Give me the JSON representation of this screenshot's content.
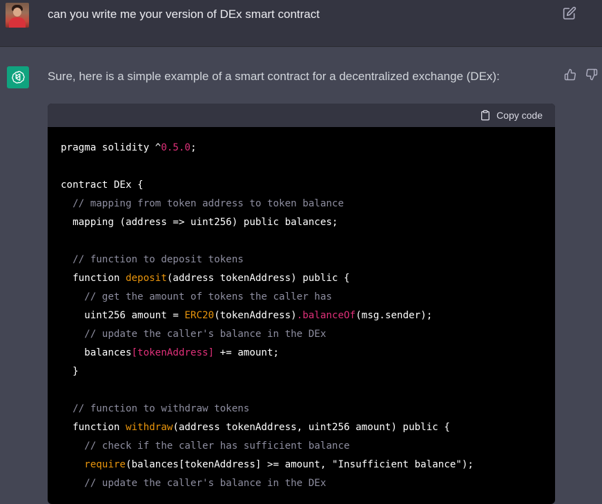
{
  "user_message": {
    "text": "can you write me your version of DEx smart contract"
  },
  "assistant_message": {
    "text": "Sure, here is a simple example of a smart contract for a decentralized exchange (DEx):"
  },
  "code_block": {
    "copy_label": "Copy code",
    "lines": [
      [
        {
          "t": "pragma solidity ^",
          "c": ""
        },
        {
          "t": "0.5.0",
          "c": "num"
        },
        {
          "t": ";",
          "c": ""
        }
      ],
      [],
      [
        {
          "t": "contract DEx {",
          "c": ""
        }
      ],
      [
        {
          "t": "  // mapping from token address to token balance",
          "c": "cmt"
        }
      ],
      [
        {
          "t": "  mapping (address => uint256) public balances;",
          "c": ""
        }
      ],
      [],
      [
        {
          "t": "  // function to deposit tokens",
          "c": "cmt"
        }
      ],
      [
        {
          "t": "  function ",
          "c": ""
        },
        {
          "t": "deposit",
          "c": "fn"
        },
        {
          "t": "(address tokenAddress) public {",
          "c": ""
        }
      ],
      [
        {
          "t": "    // get the amount of tokens the caller has",
          "c": "cmt"
        }
      ],
      [
        {
          "t": "    uint256 amount = ",
          "c": ""
        },
        {
          "t": "ERC20",
          "c": "fn"
        },
        {
          "t": "(tokenAddress)",
          "c": ""
        },
        {
          "t": ".balanceOf",
          "c": "red"
        },
        {
          "t": "(msg.sender);",
          "c": ""
        }
      ],
      [
        {
          "t": "    // update the caller's balance in the DEx",
          "c": "cmt"
        }
      ],
      [
        {
          "t": "    balances",
          "c": ""
        },
        {
          "t": "[tokenAddress]",
          "c": "red"
        },
        {
          "t": " += amount;",
          "c": ""
        }
      ],
      [
        {
          "t": "  }",
          "c": ""
        }
      ],
      [],
      [
        {
          "t": "  // function to withdraw tokens",
          "c": "cmt"
        }
      ],
      [
        {
          "t": "  function ",
          "c": ""
        },
        {
          "t": "withdraw",
          "c": "fn"
        },
        {
          "t": "(address tokenAddress, uint256 amount) public {",
          "c": ""
        }
      ],
      [
        {
          "t": "    // check if the caller has sufficient balance",
          "c": "cmt"
        }
      ],
      [
        {
          "t": "    ",
          "c": ""
        },
        {
          "t": "require",
          "c": "fn"
        },
        {
          "t": "(balances[tokenAddress] >= amount, \"Insufficient balance\");",
          "c": ""
        }
      ],
      [
        {
          "t": "    // update the caller's balance in the DEx",
          "c": "cmt"
        }
      ]
    ]
  },
  "icons": {
    "edit": "edit-icon",
    "copy": "clipboard-icon",
    "like": "thumbs-up-icon",
    "dislike": "thumbs-down-icon",
    "bot": "openai-logo-icon"
  },
  "colors": {
    "accent_bot": "#10a37f",
    "comment": "#8e8ea0",
    "number": "#df3079",
    "function": "#e9950c"
  }
}
